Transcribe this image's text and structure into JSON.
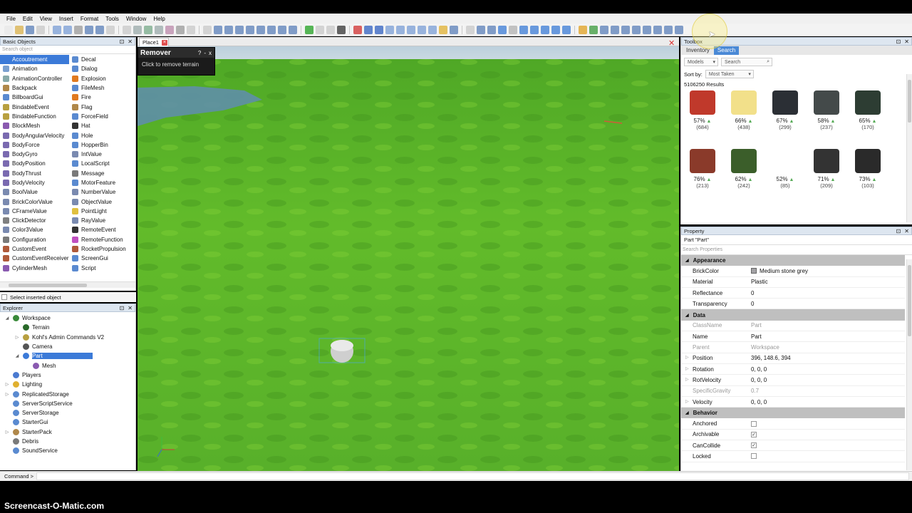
{
  "menubar": [
    "File",
    "Edit",
    "View",
    "Insert",
    "Format",
    "Tools",
    "Window",
    "Help"
  ],
  "basic_objects": {
    "title": "Basic Objects",
    "search_placeholder": "Search object",
    "col1": [
      "Accoutrement",
      "Animation",
      "AnimationController",
      "Backpack",
      "BillboardGui",
      "BindableEvent",
      "BindableFunction",
      "BlockMesh",
      "BodyAngularVelocity",
      "BodyForce",
      "BodyGyro",
      "BodyPosition",
      "BodyThrust",
      "BodyVelocity",
      "BoolValue",
      "BrickColorValue",
      "CFrameValue",
      "ClickDetector",
      "Color3Value",
      "Configuration",
      "CustomEvent",
      "CustomEventReceiver",
      "CylinderMesh"
    ],
    "col2": [
      "Decal",
      "Dialog",
      "Explosion",
      "FileMesh",
      "Fire",
      "Flag",
      "ForceField",
      "Hat",
      "Hole",
      "HopperBin",
      "IntValue",
      "LocalScript",
      "Message",
      "MotorFeature",
      "NumberValue",
      "ObjectValue",
      "PointLight",
      "RayValue",
      "RemoteEvent",
      "RemoteFunction",
      "RocketPropulsion",
      "ScreenGui",
      "Script"
    ],
    "selected": "Accoutrement",
    "select_inserted": "Select inserted object"
  },
  "explorer": {
    "title": "Explorer",
    "nodes": [
      {
        "label": "Workspace",
        "depth": 0,
        "arrow": "◢"
      },
      {
        "label": "Terrain",
        "depth": 1,
        "arrow": ""
      },
      {
        "label": "Kohl's Admin Commands V2",
        "depth": 1,
        "arrow": "▷"
      },
      {
        "label": "Camera",
        "depth": 1,
        "arrow": ""
      },
      {
        "label": "Part",
        "depth": 1,
        "arrow": "◢",
        "selected": true
      },
      {
        "label": "Mesh",
        "depth": 2,
        "arrow": ""
      },
      {
        "label": "Players",
        "depth": 0,
        "arrow": ""
      },
      {
        "label": "Lighting",
        "depth": 0,
        "arrow": "▷"
      },
      {
        "label": "ReplicatedStorage",
        "depth": 0,
        "arrow": "▷"
      },
      {
        "label": "ServerScriptService",
        "depth": 0,
        "arrow": ""
      },
      {
        "label": "ServerStorage",
        "depth": 0,
        "arrow": ""
      },
      {
        "label": "StarterGui",
        "depth": 0,
        "arrow": ""
      },
      {
        "label": "StarterPack",
        "depth": 0,
        "arrow": "▷"
      },
      {
        "label": "Debris",
        "depth": 0,
        "arrow": ""
      },
      {
        "label": "SoundService",
        "depth": 0,
        "arrow": ""
      }
    ]
  },
  "viewport": {
    "tab": "Place1",
    "remover": {
      "title": "Remover",
      "help": "?",
      "min": "-",
      "close": "x",
      "hint": "Click to remove terrain"
    }
  },
  "toolbox": {
    "title": "Toolbox",
    "tabs": [
      "Inventory",
      "Search"
    ],
    "active_tab": "Search",
    "category": "Models",
    "search_placeholder": "Search",
    "sort_label": "Sort by:",
    "sort_value": "Most Taken",
    "results": "5106250 Results",
    "models": [
      {
        "pct": "57%",
        "count": "(684)",
        "color": "#c0392b"
      },
      {
        "pct": "66%",
        "count": "(438)",
        "color": "#f2e08a"
      },
      {
        "pct": "67%",
        "count": "(299)",
        "color": "#2b2f35"
      },
      {
        "pct": "58%",
        "count": "(237)",
        "color": "#444a4a"
      },
      {
        "pct": "65%",
        "count": "(170)",
        "color": "#2d3d33"
      },
      {
        "pct": "76%",
        "count": "(213)",
        "color": "#8a3a2a"
      },
      {
        "pct": "62%",
        "count": "(242)",
        "color": "#3b5e2a"
      },
      {
        "pct": "52%",
        "count": "(85)",
        "color": "#ffffff"
      },
      {
        "pct": "71%",
        "count": "(209)",
        "color": "#333333"
      },
      {
        "pct": "73%",
        "count": "(103)",
        "color": "#2a2a2a"
      }
    ]
  },
  "properties": {
    "title": "Property",
    "object": "Part \"Part\"",
    "search_placeholder": "Search Properties",
    "rows": [
      {
        "cat": "Appearance"
      },
      {
        "name": "BrickColor",
        "value": "Medium stone grey",
        "swatch": "#a3a2a5"
      },
      {
        "name": "Material",
        "value": "Plastic"
      },
      {
        "name": "Reflectance",
        "value": "0"
      },
      {
        "name": "Transparency",
        "value": "0"
      },
      {
        "cat": "Data"
      },
      {
        "name": "ClassName",
        "value": "Part",
        "dim": true
      },
      {
        "name": "Name",
        "value": "Part"
      },
      {
        "name": "Parent",
        "value": "Workspace",
        "dim": true
      },
      {
        "name": "Position",
        "value": "396, 148.6, 394",
        "exp": true
      },
      {
        "name": "Rotation",
        "value": "0, 0, 0",
        "exp": true
      },
      {
        "name": "RotVelocity",
        "value": "0, 0, 0",
        "exp": true
      },
      {
        "name": "SpecificGravity",
        "value": "0.7",
        "dim": true
      },
      {
        "name": "Velocity",
        "value": "0, 0, 0",
        "exp": true
      },
      {
        "cat": "Behavior"
      },
      {
        "name": "Anchored",
        "check": false
      },
      {
        "name": "Archivable",
        "check": true
      },
      {
        "name": "CanCollide",
        "check": true
      },
      {
        "name": "Locked",
        "check": false
      }
    ]
  },
  "command": {
    "label": "Command >"
  },
  "watermark": "Screencast-O-Matic.com"
}
